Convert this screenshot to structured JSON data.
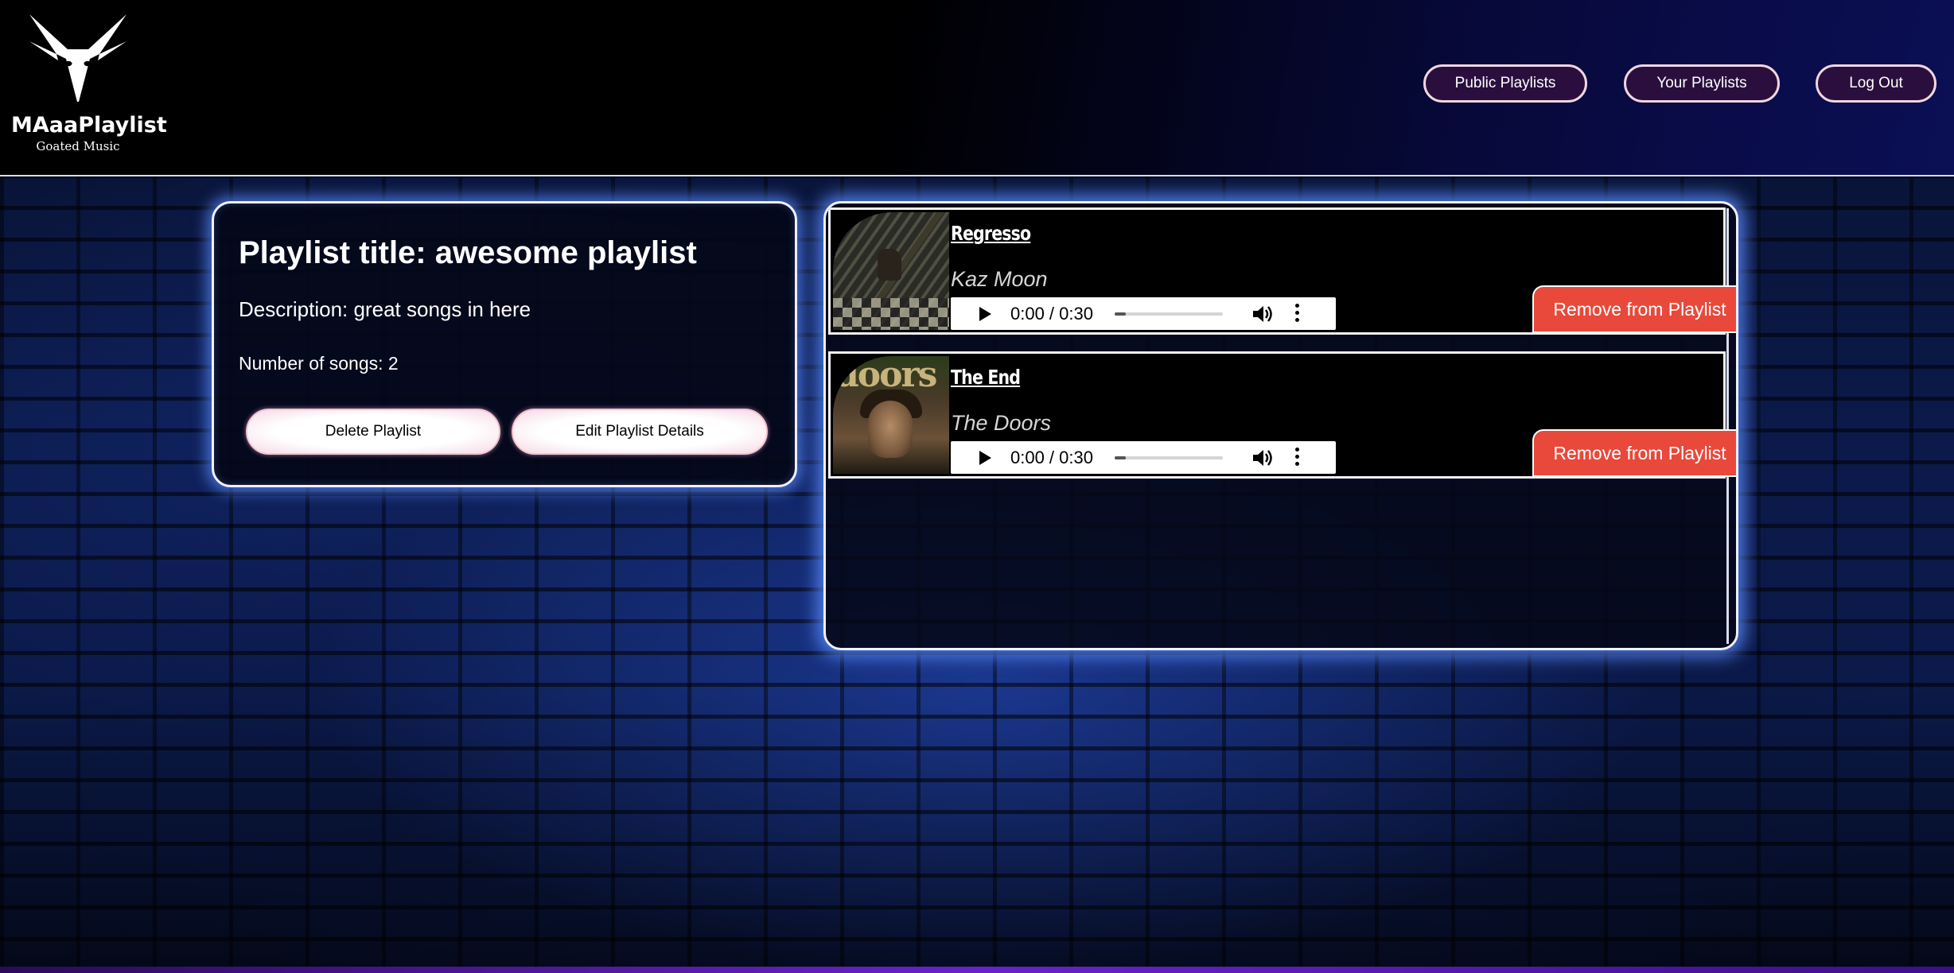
{
  "header": {
    "logo_name": "MAaaPlaylist",
    "logo_tagline": "Goated Music",
    "nav": {
      "public_playlists": "Public Playlists",
      "your_playlists": "Your Playlists",
      "log_out": "Log Out"
    }
  },
  "playlist": {
    "title_text": "Playlist title: awesome playlist",
    "description_text": "Description: great songs in here",
    "song_count_text": "Number of songs: 2",
    "delete_label": "Delete Playlist",
    "edit_label": "Edit Playlist Details"
  },
  "songs": [
    {
      "title": "Regresso",
      "artist": "Kaz Moon",
      "time": "0:00 / 0:30",
      "progress_fraction": 0.0,
      "remove_label": "Remove from Playlist"
    },
    {
      "title": "The End",
      "artist": "The Doors",
      "album_logo_text": "doors",
      "time": "0:00 / 0:30",
      "progress_fraction": 0.0,
      "remove_label": "Remove from Playlist"
    }
  ],
  "icons": {
    "logo": "goat-head-icon",
    "play": "play-icon",
    "volume": "volume-icon",
    "more": "more-options-icon"
  },
  "colors": {
    "remove_button": "#e8493b",
    "nav_button_bg": "#2a0f3e",
    "panel_glow": "#5a8cff"
  }
}
